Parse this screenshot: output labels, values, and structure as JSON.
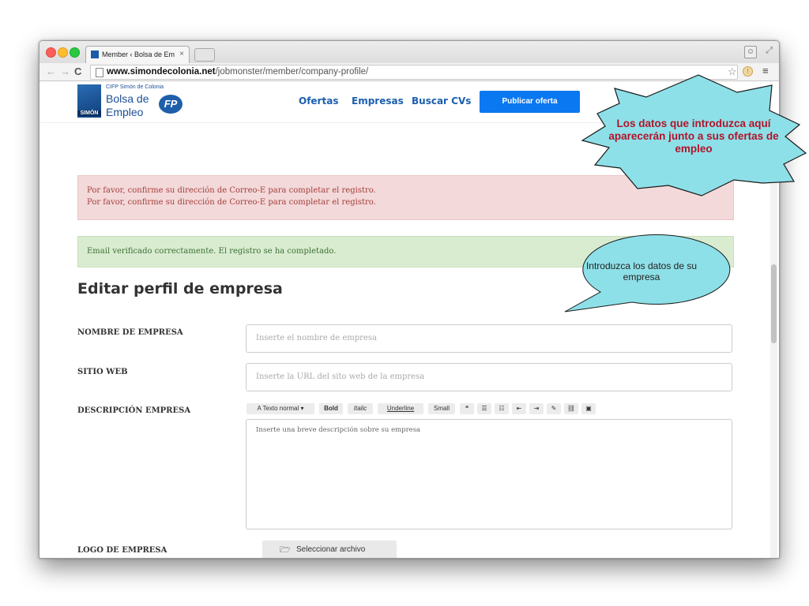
{
  "browser": {
    "tab_title": "Member ‹ Bolsa de Emplea",
    "tab_close": "×",
    "url_host": "www.simondecolonia.net",
    "url_path": "/jobmonster/member/company-profile/"
  },
  "site": {
    "logo_small": "CIFP Simón de Colonia",
    "logo_line1": "Bolsa de",
    "logo_line2": "Empleo",
    "logo_side": "SIMÓN",
    "logo_badge": "FP",
    "nav": [
      "Ofertas",
      "Empresas",
      "Buscar CVs"
    ],
    "publish_button": "Publicar oferta"
  },
  "alerts": {
    "danger": [
      "Por favor, confirme su dirección de Correo-E para completar el registro.",
      "Por favor, confirme su dirección de Correo-E para completar el registro."
    ],
    "success": "Email verificado correctamente. El registro se ha completado."
  },
  "form": {
    "title": "Editar perfil de empresa",
    "company_name_label": "NOMBRE DE EMPRESA",
    "company_name_placeholder": "Inserte el nombre de empresa",
    "website_label": "SITIO WEB",
    "website_placeholder": "Inserte la URL del sito web de la empresa",
    "description_label": "DESCRIPCIÓN EMPRESA",
    "description_placeholder": "Inserte una breve descripción sobre su empresa",
    "logo_label": "LOGO DE EMPRESA",
    "file_button": "Seleccionar archivo"
  },
  "editor_toolbar": {
    "style_dropdown": "A Texto normal ▾",
    "bold": "Bold",
    "italic": "Italic",
    "underline": "Underline",
    "small": "Small",
    "quote_icon": "❝",
    "ul_icon": "☰",
    "ol_icon": "☷",
    "outdent_icon": "⇤",
    "indent_icon": "⇥",
    "pencil_icon": "✎",
    "link_icon": "⛓",
    "image_icon": "▣"
  },
  "callouts": {
    "explosion": "Los datos que introduzca aquí aparecerán junto a sus ofertas de empleo",
    "speech": "Introduzca los datos de su empresa"
  },
  "colors": {
    "accent": "#0a78f1",
    "nav_text": "#1b5fae",
    "danger_bg": "#f3d9da",
    "success_bg": "#d9ecd0",
    "callout_fill": "#8ee0e8",
    "callout_text": "#b0142a"
  }
}
